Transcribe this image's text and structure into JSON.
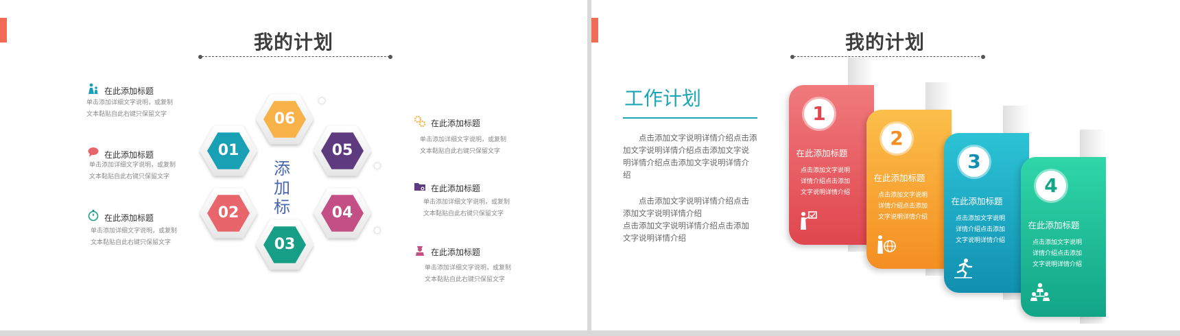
{
  "slide1": {
    "title": "我的计划",
    "hexagons": [
      {
        "label": "06",
        "color": "#f7b24a"
      },
      {
        "label": "01",
        "color": "#1aa0b5"
      },
      {
        "label": "05",
        "color": "#5e3a7e"
      },
      {
        "label": "02",
        "color": "#e8656b"
      },
      {
        "label": "04",
        "color": "#c44f85"
      },
      {
        "label": "03",
        "color": "#179e86"
      }
    ],
    "center_text": "添加标",
    "left_items": [
      {
        "title": "在此添加标题",
        "desc1": "单击添加详细文字说明，或复制",
        "desc2": "文本黏贴自此右键只保留文字",
        "icon": "people-icon",
        "color": "#1aa0b5"
      },
      {
        "title": "在此添加标题",
        "desc1": "单击添加详细文字说明，或复制",
        "desc2": "文本黏贴自此右键只保留文字",
        "icon": "chat-icon",
        "color": "#e8656b"
      },
      {
        "title": "在此添加标题",
        "desc1": "单击添加详细文字说明，或复制",
        "desc2": "文本黏贴自此右键只保留文字",
        "icon": "stopwatch-icon",
        "color": "#179e86"
      }
    ],
    "right_items": [
      {
        "title": "在此添加标题",
        "desc1": "单击添加详细文字说明，或复制",
        "desc2": "文本黏贴自此右键只保留文字",
        "icon": "gears-icon",
        "color": "#f7b24a"
      },
      {
        "title": "在此添加标题",
        "desc1": "单击添加详细文字说明，或复制",
        "desc2": "文本黏贴自此右键只保留文字",
        "icon": "folder-icon",
        "color": "#5e3a7e"
      },
      {
        "title": "在此添加标题",
        "desc1": "单击添加详细文字说明，或复制",
        "desc2": "文本黏贴自此右键只保留文字",
        "icon": "nurse-icon",
        "color": "#c44f85"
      }
    ]
  },
  "slide2": {
    "title": "我的计划",
    "subtitle": "工作计划",
    "para1": [
      "　　点击添加文字说明详情介绍点击添",
      "加文字说明详情介绍点击添加文字说",
      "明详情介绍点击添加文字说明详情介",
      "绍"
    ],
    "para2": [
      "　　点击添加文字说明详情介绍点击",
      "添加文字说明详情介绍",
      "点击添加文字说明详情介绍点击添加",
      "文字说明详情介绍"
    ],
    "cards": [
      {
        "num": "1",
        "title": "在此添加标题",
        "desc": [
          "点击添加文字说明",
          "详情介绍点击添加",
          "文字说明详情介绍"
        ],
        "color_top": "#f07a7c",
        "color_bottom": "#e0464e",
        "icon": "presenter-icon"
      },
      {
        "num": "2",
        "title": "在此添加标题",
        "desc": [
          "点击添加文字说明",
          "详情介绍点击添加",
          "文字说明详情介绍"
        ],
        "color_top": "#fbbf4a",
        "color_bottom": "#f48e22",
        "icon": "globe-presenter-icon"
      },
      {
        "num": "3",
        "title": "在此添加标题",
        "desc": [
          "点击添加文字说明",
          "详情介绍点击添加",
          "文字说明详情介绍"
        ],
        "color_top": "#2cc3d6",
        "color_bottom": "#118fb0",
        "icon": "runner-icon"
      },
      {
        "num": "4",
        "title": "在此添加标题",
        "desc": [
          "点击添加文字说明",
          "详情介绍点击添加",
          "文字说明详情介绍"
        ],
        "color_top": "#2fd6a8",
        "color_bottom": "#12a587",
        "icon": "team-icon"
      }
    ]
  }
}
